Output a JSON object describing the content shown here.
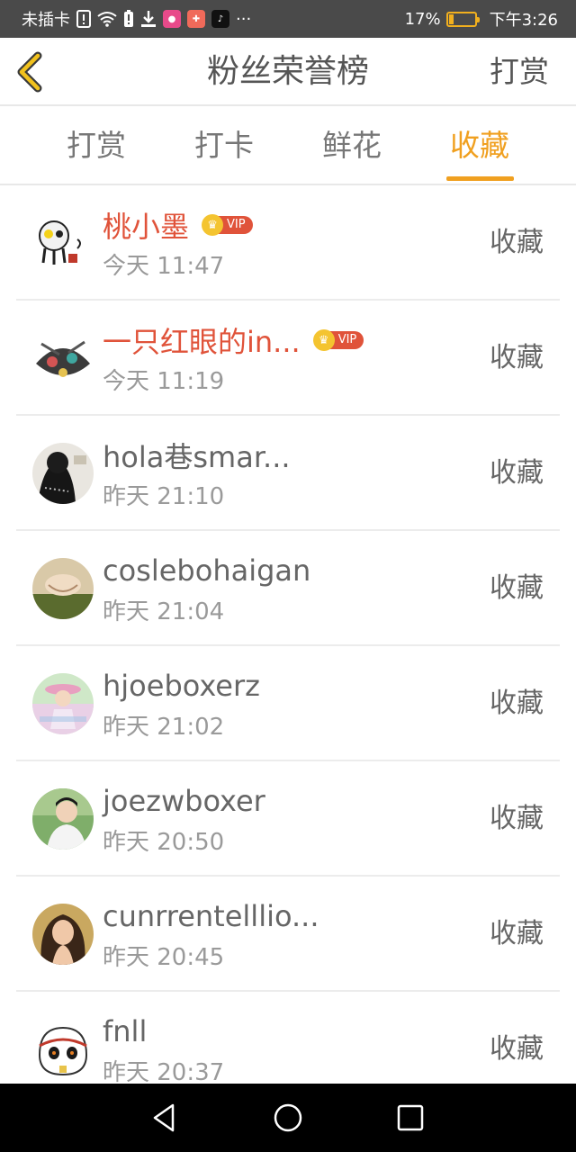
{
  "status_bar": {
    "carrier": "未插卡",
    "battery_percent_text": "17%",
    "battery_level": 0.17,
    "time": "下午3:26",
    "more": "···"
  },
  "header": {
    "title": "粉丝荣誉榜",
    "action_label": "打赏"
  },
  "tabs": [
    {
      "label": "打赏",
      "active": false
    },
    {
      "label": "打卡",
      "active": false
    },
    {
      "label": "鲜花",
      "active": false
    },
    {
      "label": "收藏",
      "active": true
    }
  ],
  "entries": [
    {
      "name": "桃小墨",
      "vip": true,
      "vip_label": "VIP",
      "time": "今天 11:47",
      "action": "收藏"
    },
    {
      "name": "一只红眼的in...",
      "vip": true,
      "vip_label": "VIP",
      "time": "今天 11:19",
      "action": "收藏"
    },
    {
      "name": "hola巷smar...",
      "vip": false,
      "time": "昨天 21:10",
      "action": "收藏"
    },
    {
      "name": "coslebohaigan",
      "vip": false,
      "time": "昨天 21:04",
      "action": "收藏"
    },
    {
      "name": "hjoeboxerz",
      "vip": false,
      "time": "昨天 21:02",
      "action": "收藏"
    },
    {
      "name": "joezwboxer",
      "vip": false,
      "time": "昨天 20:50",
      "action": "收藏"
    },
    {
      "name": "cunrrentelllio...",
      "vip": false,
      "time": "昨天 20:45",
      "action": "收藏"
    },
    {
      "name": "fnll",
      "vip": false,
      "time": "昨天 20:37",
      "action": "收藏"
    }
  ],
  "colors": {
    "accent": "#f0a020",
    "vip_name": "#e0533a",
    "text": "#666666",
    "subtext": "#9a9a9a"
  }
}
